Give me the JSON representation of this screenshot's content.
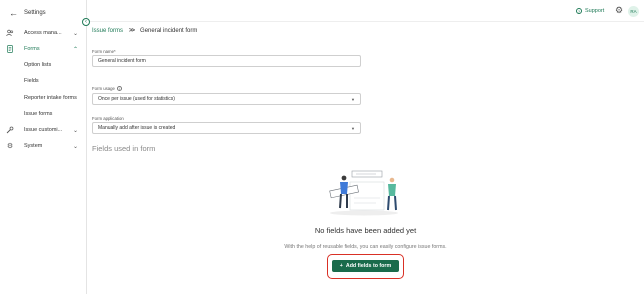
{
  "sidebar": {
    "header_title": "Settings",
    "items": [
      {
        "label": "Access mana...",
        "icon": "users-icon"
      },
      {
        "label": "Forms",
        "icon": "document-icon",
        "active": true
      },
      {
        "label": "Issue customi...",
        "icon": "wrench-icon"
      },
      {
        "label": "System",
        "icon": "gear-icon"
      }
    ],
    "forms_subitems": [
      "Option lists",
      "Fields",
      "Reporter intake forms",
      "Issue forms"
    ]
  },
  "topbar": {
    "support_label": "Support",
    "avatar_initials": "RA"
  },
  "breadcrumb": {
    "parent": "Issue forms",
    "current": "General incident form"
  },
  "form": {
    "name_label": "Form name*",
    "name_value": "General incident form",
    "usage_label": "Form usage",
    "usage_value": "Once per issue (used for statistics)",
    "application_label": "Form application",
    "application_value": "Manually add after issue is created"
  },
  "fields_section_title": "Fields used in form",
  "empty_state": {
    "title": "No fields have been added yet",
    "description": "With the help of reusable fields, you can easily configure issue forms.",
    "button_label": "Add fields to form"
  },
  "colors": {
    "accent": "#1f7a57",
    "button": "#1a6b4b",
    "highlight": "#d93025"
  }
}
